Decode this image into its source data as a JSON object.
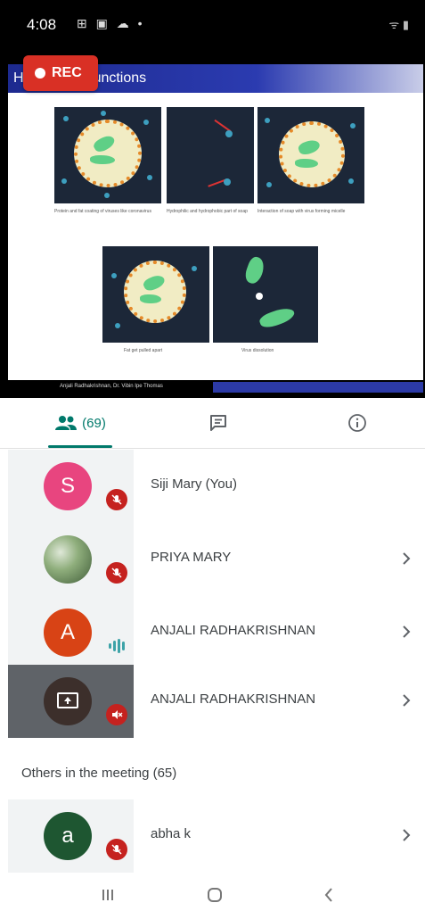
{
  "status_bar": {
    "time": "4:08",
    "left_icons": "⊞ ▣ ☁ •",
    "right_icons": "ᯤ ▮"
  },
  "presentation": {
    "title": "H",
    "title_tail": "unctions",
    "rec_label": "REC",
    "captions": [
      "Protein and fat coating of viruses like coronavirus",
      "Hydrophilic and hydrophobic part of soap",
      "Interaction of soap with virus forming micelle",
      "Fat get pulled apart",
      "Virus dissolution"
    ],
    "footer_text": "Anjali Radhakrishnan, Dr. Vibin Ipe Thomas"
  },
  "tabs": {
    "people_count": "(69)"
  },
  "participants": [
    {
      "initial": "S",
      "name": "Siji Mary (You)",
      "color": "#e8457f",
      "state": "muted"
    },
    {
      "initial": "",
      "name": "PRIYA MARY",
      "color": "#7a9a6a",
      "state": "muted"
    },
    {
      "initial": "A",
      "name": "ANJALI RADHAKRISHNAN",
      "color": "#d84315",
      "state": "speaking"
    },
    {
      "initial": "",
      "name": "ANJALI RADHAKRISHNAN",
      "color": "#3c2f2b",
      "state": "presenting"
    }
  ],
  "others": {
    "header": "Others in the meeting (65)",
    "items": [
      {
        "initial": "a",
        "name": "abha k",
        "color": "#1e5631"
      }
    ]
  },
  "colors": {
    "accent": "#00796b",
    "rec": "#d93025",
    "mute": "#c5221f"
  }
}
